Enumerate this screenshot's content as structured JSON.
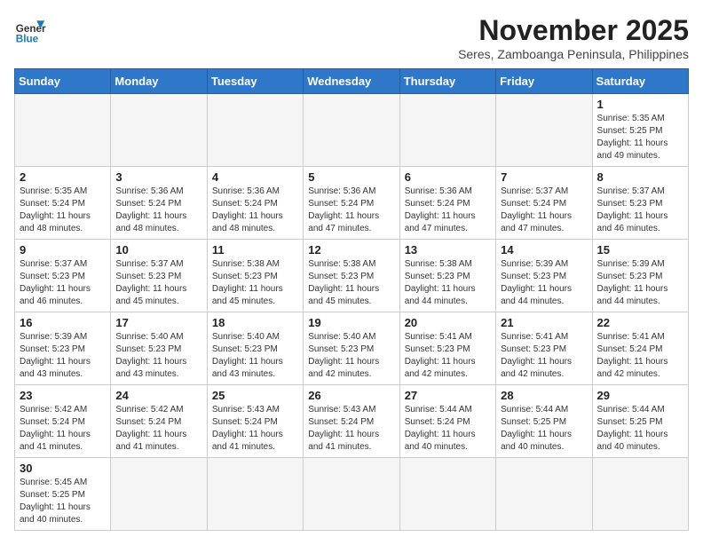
{
  "logo": {
    "text_general": "General",
    "text_blue": "Blue"
  },
  "header": {
    "month": "November 2025",
    "location": "Seres, Zamboanga Peninsula, Philippines"
  },
  "weekdays": [
    "Sunday",
    "Monday",
    "Tuesday",
    "Wednesday",
    "Thursday",
    "Friday",
    "Saturday"
  ],
  "weeks": [
    [
      {
        "day": "",
        "sunrise": "",
        "sunset": "",
        "daylight": ""
      },
      {
        "day": "",
        "sunrise": "",
        "sunset": "",
        "daylight": ""
      },
      {
        "day": "",
        "sunrise": "",
        "sunset": "",
        "daylight": ""
      },
      {
        "day": "",
        "sunrise": "",
        "sunset": "",
        "daylight": ""
      },
      {
        "day": "",
        "sunrise": "",
        "sunset": "",
        "daylight": ""
      },
      {
        "day": "",
        "sunrise": "",
        "sunset": "",
        "daylight": ""
      },
      {
        "day": "1",
        "sunrise": "Sunrise: 5:35 AM",
        "sunset": "Sunset: 5:25 PM",
        "daylight": "Daylight: 11 hours and 49 minutes."
      }
    ],
    [
      {
        "day": "2",
        "sunrise": "Sunrise: 5:35 AM",
        "sunset": "Sunset: 5:24 PM",
        "daylight": "Daylight: 11 hours and 48 minutes."
      },
      {
        "day": "3",
        "sunrise": "Sunrise: 5:36 AM",
        "sunset": "Sunset: 5:24 PM",
        "daylight": "Daylight: 11 hours and 48 minutes."
      },
      {
        "day": "4",
        "sunrise": "Sunrise: 5:36 AM",
        "sunset": "Sunset: 5:24 PM",
        "daylight": "Daylight: 11 hours and 48 minutes."
      },
      {
        "day": "5",
        "sunrise": "Sunrise: 5:36 AM",
        "sunset": "Sunset: 5:24 PM",
        "daylight": "Daylight: 11 hours and 47 minutes."
      },
      {
        "day": "6",
        "sunrise": "Sunrise: 5:36 AM",
        "sunset": "Sunset: 5:24 PM",
        "daylight": "Daylight: 11 hours and 47 minutes."
      },
      {
        "day": "7",
        "sunrise": "Sunrise: 5:37 AM",
        "sunset": "Sunset: 5:24 PM",
        "daylight": "Daylight: 11 hours and 47 minutes."
      },
      {
        "day": "8",
        "sunrise": "Sunrise: 5:37 AM",
        "sunset": "Sunset: 5:23 PM",
        "daylight": "Daylight: 11 hours and 46 minutes."
      }
    ],
    [
      {
        "day": "9",
        "sunrise": "Sunrise: 5:37 AM",
        "sunset": "Sunset: 5:23 PM",
        "daylight": "Daylight: 11 hours and 46 minutes."
      },
      {
        "day": "10",
        "sunrise": "Sunrise: 5:37 AM",
        "sunset": "Sunset: 5:23 PM",
        "daylight": "Daylight: 11 hours and 45 minutes."
      },
      {
        "day": "11",
        "sunrise": "Sunrise: 5:38 AM",
        "sunset": "Sunset: 5:23 PM",
        "daylight": "Daylight: 11 hours and 45 minutes."
      },
      {
        "day": "12",
        "sunrise": "Sunrise: 5:38 AM",
        "sunset": "Sunset: 5:23 PM",
        "daylight": "Daylight: 11 hours and 45 minutes."
      },
      {
        "day": "13",
        "sunrise": "Sunrise: 5:38 AM",
        "sunset": "Sunset: 5:23 PM",
        "daylight": "Daylight: 11 hours and 44 minutes."
      },
      {
        "day": "14",
        "sunrise": "Sunrise: 5:39 AM",
        "sunset": "Sunset: 5:23 PM",
        "daylight": "Daylight: 11 hours and 44 minutes."
      },
      {
        "day": "15",
        "sunrise": "Sunrise: 5:39 AM",
        "sunset": "Sunset: 5:23 PM",
        "daylight": "Daylight: 11 hours and 44 minutes."
      }
    ],
    [
      {
        "day": "16",
        "sunrise": "Sunrise: 5:39 AM",
        "sunset": "Sunset: 5:23 PM",
        "daylight": "Daylight: 11 hours and 43 minutes."
      },
      {
        "day": "17",
        "sunrise": "Sunrise: 5:40 AM",
        "sunset": "Sunset: 5:23 PM",
        "daylight": "Daylight: 11 hours and 43 minutes."
      },
      {
        "day": "18",
        "sunrise": "Sunrise: 5:40 AM",
        "sunset": "Sunset: 5:23 PM",
        "daylight": "Daylight: 11 hours and 43 minutes."
      },
      {
        "day": "19",
        "sunrise": "Sunrise: 5:40 AM",
        "sunset": "Sunset: 5:23 PM",
        "daylight": "Daylight: 11 hours and 42 minutes."
      },
      {
        "day": "20",
        "sunrise": "Sunrise: 5:41 AM",
        "sunset": "Sunset: 5:23 PM",
        "daylight": "Daylight: 11 hours and 42 minutes."
      },
      {
        "day": "21",
        "sunrise": "Sunrise: 5:41 AM",
        "sunset": "Sunset: 5:23 PM",
        "daylight": "Daylight: 11 hours and 42 minutes."
      },
      {
        "day": "22",
        "sunrise": "Sunrise: 5:41 AM",
        "sunset": "Sunset: 5:24 PM",
        "daylight": "Daylight: 11 hours and 42 minutes."
      }
    ],
    [
      {
        "day": "23",
        "sunrise": "Sunrise: 5:42 AM",
        "sunset": "Sunset: 5:24 PM",
        "daylight": "Daylight: 11 hours and 41 minutes."
      },
      {
        "day": "24",
        "sunrise": "Sunrise: 5:42 AM",
        "sunset": "Sunset: 5:24 PM",
        "daylight": "Daylight: 11 hours and 41 minutes."
      },
      {
        "day": "25",
        "sunrise": "Sunrise: 5:43 AM",
        "sunset": "Sunset: 5:24 PM",
        "daylight": "Daylight: 11 hours and 41 minutes."
      },
      {
        "day": "26",
        "sunrise": "Sunrise: 5:43 AM",
        "sunset": "Sunset: 5:24 PM",
        "daylight": "Daylight: 11 hours and 41 minutes."
      },
      {
        "day": "27",
        "sunrise": "Sunrise: 5:44 AM",
        "sunset": "Sunset: 5:24 PM",
        "daylight": "Daylight: 11 hours and 40 minutes."
      },
      {
        "day": "28",
        "sunrise": "Sunrise: 5:44 AM",
        "sunset": "Sunset: 5:25 PM",
        "daylight": "Daylight: 11 hours and 40 minutes."
      },
      {
        "day": "29",
        "sunrise": "Sunrise: 5:44 AM",
        "sunset": "Sunset: 5:25 PM",
        "daylight": "Daylight: 11 hours and 40 minutes."
      }
    ],
    [
      {
        "day": "30",
        "sunrise": "Sunrise: 5:45 AM",
        "sunset": "Sunset: 5:25 PM",
        "daylight": "Daylight: 11 hours and 40 minutes."
      },
      {
        "day": "",
        "sunrise": "",
        "sunset": "",
        "daylight": ""
      },
      {
        "day": "",
        "sunrise": "",
        "sunset": "",
        "daylight": ""
      },
      {
        "day": "",
        "sunrise": "",
        "sunset": "",
        "daylight": ""
      },
      {
        "day": "",
        "sunrise": "",
        "sunset": "",
        "daylight": ""
      },
      {
        "day": "",
        "sunrise": "",
        "sunset": "",
        "daylight": ""
      },
      {
        "day": "",
        "sunrise": "",
        "sunset": "",
        "daylight": ""
      }
    ]
  ]
}
